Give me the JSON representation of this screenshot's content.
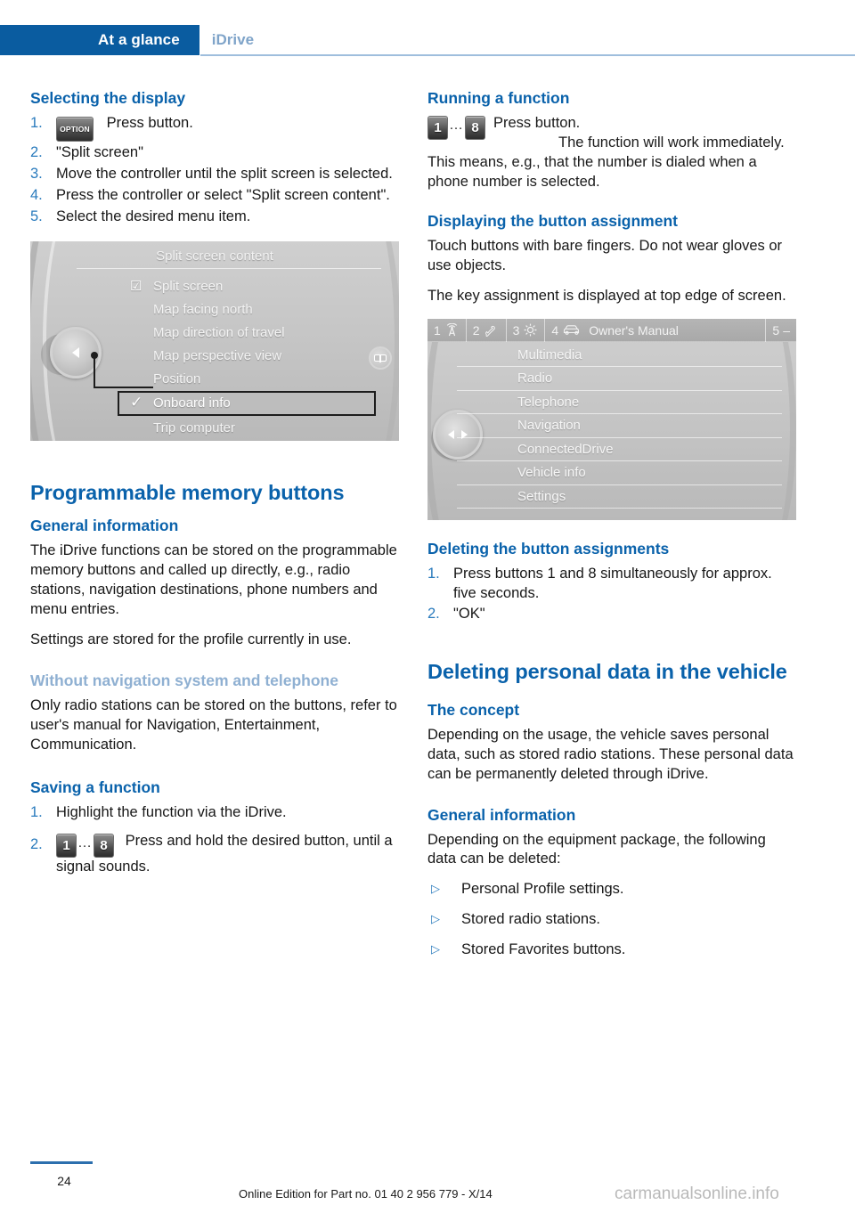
{
  "header": {
    "tab_primary": "At a glance",
    "tab_secondary": "iDrive",
    "accent_blue": "#0a5ca0",
    "muted_blue": "#7fa4c9"
  },
  "left_column": {
    "heading_selecting": "Selecting the display",
    "steps_selecting": [
      {
        "num": "1.",
        "icon": "OPTION",
        "text": "Press button."
      },
      {
        "num": "2.",
        "text": "\"Split screen\""
      },
      {
        "num": "3.",
        "text": "Move the controller until the split screen is selected."
      },
      {
        "num": "4.",
        "text": "Press the controller or select \"Split screen content\"."
      },
      {
        "num": "5.",
        "text": "Select the desired menu item."
      }
    ],
    "screen_split": {
      "title": "Split screen content",
      "items": [
        {
          "label": "Split screen",
          "mark": "checkbox",
          "selected": false
        },
        {
          "label": "Map facing north",
          "mark": "",
          "selected": false
        },
        {
          "label": "Map direction of travel",
          "mark": "",
          "selected": false
        },
        {
          "label": "Map perspective view",
          "mark": "",
          "selected": false
        },
        {
          "label": "Position",
          "mark": "",
          "selected": false
        },
        {
          "label": "Onboard info",
          "mark": "check",
          "selected": true
        },
        {
          "label": "Trip computer",
          "mark": "",
          "selected": false
        }
      ]
    },
    "heading_programmable": "Programmable memory buttons",
    "heading_general_info": "General information",
    "para_general_1": "The iDrive functions can be stored on the programmable memory buttons and called up directly, e.g., radio stations, navigation destinations, phone numbers and menu entries.",
    "para_general_2": "Settings are stored for the profile currently in use.",
    "heading_without_nav": "Without navigation system and telephone",
    "para_without_nav": "Only radio stations can be stored on the buttons, refer to user's manual for Navigation, Entertainment, Communication.",
    "heading_saving": "Saving a function",
    "steps_saving": [
      {
        "num": "1.",
        "text": "Highlight the function via the iDrive."
      },
      {
        "num": "2.",
        "icon_from": "1",
        "icon_to": "8",
        "dots": "…",
        "text": "Press and hold the desired button, until a signal sounds."
      }
    ]
  },
  "right_column": {
    "heading_running": "Running a function",
    "running_icon_from": "1",
    "running_icon_to": "8",
    "running_dots": "…",
    "running_press": "Press button.",
    "running_para": "The function will work immediately. This means, e.g., that the number is dialed when a phone number is selected.",
    "heading_displaying": "Displaying the button assignment",
    "para_displaying_1": "Touch buttons with bare fingers. Do not wear gloves or use objects.",
    "para_displaying_2": "The key assignment is displayed at top edge of screen.",
    "screen_menu": {
      "topbar": [
        {
          "n": "1",
          "icon": "radio-antenna-icon",
          "label": ""
        },
        {
          "n": "2",
          "icon": "telephone-icon",
          "label": ""
        },
        {
          "n": "3",
          "icon": "gear-icon",
          "label": ""
        },
        {
          "n": "4",
          "icon": "car-icon",
          "label": "Owner's Manual"
        },
        {
          "n": "5",
          "icon": "dash-icon",
          "label": "–"
        }
      ],
      "items": [
        "Multimedia",
        "Radio",
        "Telephone",
        "Navigation",
        "ConnectedDrive",
        "Vehicle info",
        "Settings"
      ]
    },
    "heading_deleting_assignments": "Deleting the button assignments",
    "steps_deleting": [
      {
        "num": "1.",
        "text": "Press buttons 1 and 8 simultaneously for approx. five seconds."
      },
      {
        "num": "2.",
        "text": "\"OK\""
      }
    ],
    "heading_deleting_personal": "Deleting personal data in the vehicle",
    "heading_concept": "The concept",
    "para_concept": "Depending on the usage, the vehicle saves personal data, such as stored radio stations. These personal data can be permanently deleted through iDrive.",
    "heading_general_info2": "General information",
    "para_general_info2": "Depending on the equipment package, the following data can be deleted:",
    "bullets": [
      "Personal Profile settings.",
      "Stored radio stations.",
      "Stored Favorites buttons."
    ]
  },
  "footer": {
    "page_number": "24",
    "edition": "Online Edition for Part no. 01 40 2 956 779 - X/14",
    "watermark": "carmanualsonline.info"
  }
}
